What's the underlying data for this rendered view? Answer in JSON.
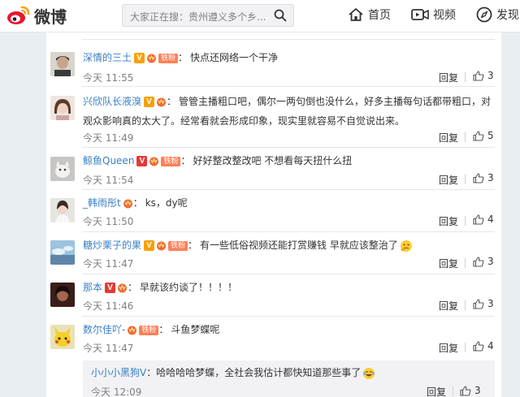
{
  "header": {
    "logo_text": "微博",
    "search_placeholder": "大家正在搜：贵州遵义多个乡...",
    "nav": [
      {
        "label": "首页",
        "icon": "home-icon"
      },
      {
        "label": "视频",
        "icon": "video-icon"
      },
      {
        "label": "发现",
        "icon": "compass-icon"
      }
    ]
  },
  "comments": [
    {
      "user": "深情的三土",
      "badge": "v-orange",
      "fan": "铁粉",
      "text": "快点还网络一个干净",
      "time": "今天 11:55",
      "reply": "回复",
      "likes": "3"
    },
    {
      "user": "兴欣队长液溴",
      "badge": "v-orange",
      "fan": "",
      "text": "管管主播粗口吧，偶尔一两句倒也没什么，好多主播每句话都带粗口，对观众影响真的太大了。经常看就会形成印象，现实里就容易不自觉说出来。",
      "time": "今天 11:49",
      "reply": "回复",
      "likes": "5"
    },
    {
      "user": "鲸鱼Queen",
      "badge": "v-red",
      "fan": "铁粉",
      "text": "好好整改整改吧 不想看每天扭什么扭",
      "time": "今天 11:54",
      "reply": "回复",
      "likes": "3"
    },
    {
      "user": "_韩雨彤t",
      "badge": "",
      "fan": "",
      "text": "ks，dy呢",
      "time": "今天 11:50",
      "reply": "回复",
      "likes": "4"
    },
    {
      "user": "糖炒栗子的果",
      "badge": "v-orange",
      "fan": "铁粉",
      "text": "有一些低俗视频还能打赏赚钱 早就应该整治了",
      "time": "今天 11:47",
      "reply": "回复",
      "likes": "3"
    },
    {
      "user": "那本",
      "badge": "v-red",
      "fan": "",
      "text": "早就该约谈了！！！！",
      "time": "今天 11:46",
      "reply": "回复",
      "likes": "3"
    },
    {
      "user": "数尔佳吖-",
      "badge": "",
      "fan": "铁粉",
      "text": "斗鱼梦蝶呢",
      "time": "今天 11:47",
      "reply": "回复",
      "likes": "4"
    }
  ],
  "sub_reply": {
    "user": "小小小黑狗V",
    "text": "哈哈哈哈梦蝶，全社会我估计都快知道那些事了",
    "time": "今天 12:09",
    "reply": "回复",
    "likes": "3"
  },
  "colors": {
    "link": "#3a7fc4",
    "accent": "#f8a000",
    "logo_red": "#e6162d"
  }
}
